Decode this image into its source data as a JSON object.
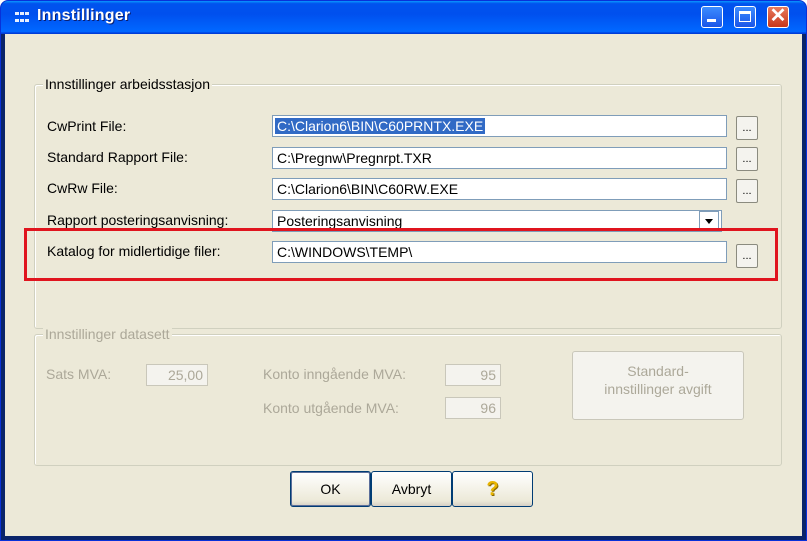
{
  "window": {
    "title": "Innstillinger"
  },
  "workstation_group": {
    "title": "Innstillinger arbeidsstasjon",
    "rows": [
      {
        "label": "CwPrint File:",
        "value": "C:\\Clarion6\\BIN\\C60PRNTX.EXE",
        "browse": "..."
      },
      {
        "label": "Standard Rapport File:",
        "value": "C:\\Pregnw\\Pregnrpt.TXR",
        "browse": "..."
      },
      {
        "label": "CwRw File:",
        "value": "C:\\Clarion6\\BIN\\C60RW.EXE",
        "browse": "..."
      },
      {
        "label": "Rapport posteringsanvisning:",
        "value": "Posteringsanvisning"
      },
      {
        "label": "Katalog for midlertidige filer:",
        "value": "C:\\WINDOWS\\TEMP\\",
        "browse": "..."
      }
    ]
  },
  "dataset_group": {
    "title": "Innstillinger datasett",
    "sats_mva_label": "Sats MVA:",
    "sats_mva_value": "25,00",
    "konto_inngaende_label": "Konto inngående MVA:",
    "konto_inngaende_value": "95",
    "konto_utgaende_label": "Konto utgående MVA:",
    "konto_utgaende_value": "96",
    "standard_button_line1": "Standard-",
    "standard_button_line2": "innstillinger avgift"
  },
  "buttons": {
    "ok": "OK",
    "cancel": "Avbryt",
    "help": "?"
  },
  "colors": {
    "highlight": "#e0141e",
    "selection": "#316ac5",
    "titlebar": "#0053ee"
  }
}
